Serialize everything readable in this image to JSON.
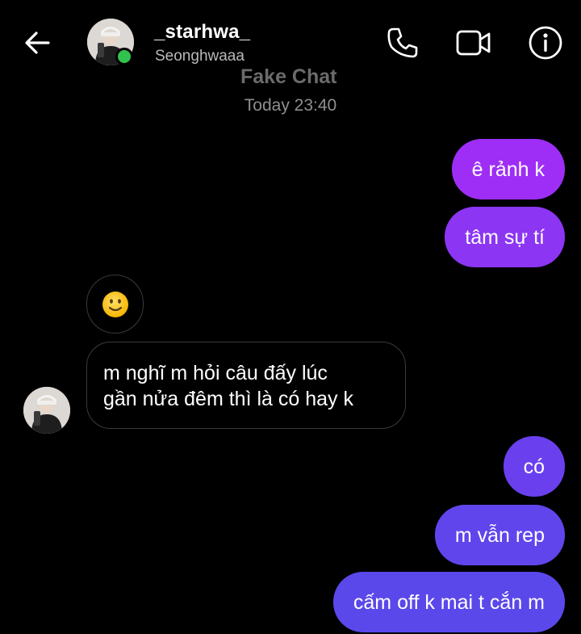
{
  "header": {
    "username": "_starhwa_",
    "display_name": "Seonghwaaa",
    "online": true,
    "icons": [
      "back-arrow-icon",
      "phone-icon",
      "video-camera-icon",
      "info-icon"
    ]
  },
  "watermark": "Fake Chat",
  "timestamp": "Today 23:40",
  "messages": [
    {
      "from": "me",
      "text": "ê rảnh k"
    },
    {
      "from": "me",
      "text": "tâm sự tí"
    },
    {
      "from": "them",
      "text": "🙂",
      "icon": "slightly-smiling-face-emoji"
    },
    {
      "from": "them",
      "text": "m nghĩ m hỏi câu đấy lúc gần nửa đêm thì là có hay k",
      "lines": [
        "m nghĩ m hỏi câu đấy lúc",
        "gần nửa đêm thì là có hay k"
      ]
    },
    {
      "from": "me",
      "text": "có"
    },
    {
      "from": "me",
      "text": "m vẫn rep"
    },
    {
      "from": "me",
      "text": "cấm off k mai t cắn m"
    }
  ],
  "colors": {
    "background": "#000000",
    "sent_bubble_top": "#9e2ef5",
    "sent_bubble_bottom": "#5b48ea",
    "received_border": "#3a3a3a",
    "online_dot": "#31c24d",
    "secondary_text": "#b9b9b9"
  }
}
